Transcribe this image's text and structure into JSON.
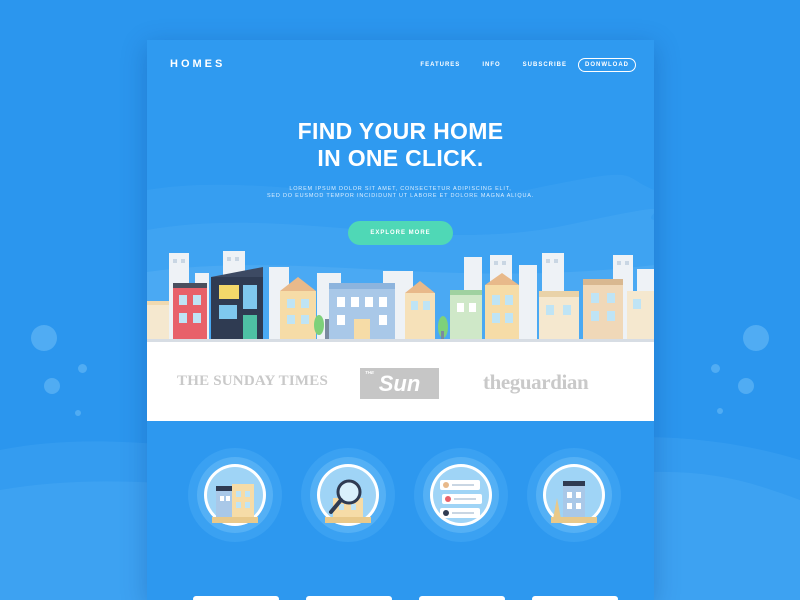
{
  "brand": "HOMES",
  "nav": {
    "links": [
      "FEATURES",
      "INFO",
      "SUBSCRIBE"
    ],
    "download": "DONWLOAD"
  },
  "hero": {
    "headline_1": "FIND YOUR HOME",
    "headline_2": "IN ONE CLICK.",
    "sub_1": "LOREM IPSUM DOLOR SIT AMET, CONSECTETUR ADIPISCING ELIT,",
    "sub_2": "SED DO EUSMOD TEMPOR INCIDIDUNT UT LABORE ET DOLORE MAGNA ALIQUA.",
    "cta": "EXPLORE MORE"
  },
  "press": {
    "sunday_times": "THE SUNDAY TIMES",
    "sun_small": "THE",
    "sun": "Sun",
    "guardian": "theguardian"
  },
  "features": {
    "icons": [
      "houses-icon",
      "magnifier-house-icon",
      "profile-cards-icon",
      "house-tree-icon"
    ]
  },
  "colors": {
    "background": "#2b96ee",
    "cta": "#4fd8b6",
    "press_logos": "#c9c9c9"
  }
}
